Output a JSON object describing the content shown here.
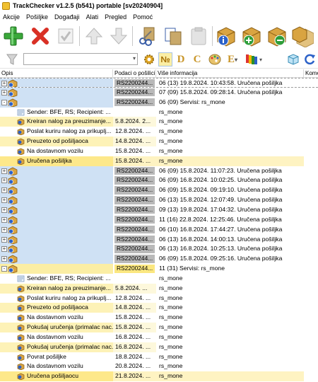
{
  "title": "TrackChecker v1.2.5 (b541)  portable [sv20240904]",
  "menu": [
    "Akcije",
    "Pošiljke",
    "Događaji",
    "Alati",
    "Pregled",
    "Pomoć"
  ],
  "toolbar1": [
    {
      "icon": "add-icon"
    },
    {
      "icon": "delete-icon"
    },
    {
      "icon": "check-icon"
    },
    {
      "icon": "arrow-up-icon"
    },
    {
      "icon": "arrow-down-icon"
    },
    {
      "icon": "cut-icon"
    },
    {
      "icon": "copy-icon"
    },
    {
      "icon": "paste-icon"
    },
    {
      "icon": "package-info-icon"
    },
    {
      "icon": "package-add-icon"
    },
    {
      "icon": "package-remove-icon"
    },
    {
      "icon": "package-refresh-icon"
    }
  ],
  "toolbar2": {
    "filter_value": "",
    "buttons": [
      {
        "icon": "gear-icon"
      },
      {
        "icon": "number-icon",
        "label": "№"
      },
      {
        "icon": "letter-d-icon",
        "label": "D"
      },
      {
        "icon": "letter-c-icon",
        "label": "C"
      },
      {
        "icon": "palette-icon"
      },
      {
        "icon": "letter-e-icon",
        "label": "E"
      },
      {
        "icon": "flags-icon"
      },
      {
        "icon": "cube-icon"
      },
      {
        "icon": "refresh-icon"
      }
    ]
  },
  "columns": {
    "c1": "Opis",
    "c2": "Podaci o pošilici",
    "c3": "Više informacija",
    "c4": "Kome"
  },
  "colors": {
    "parent_blue": "#cfe1f4",
    "parent_yellow": "#fbeea4",
    "badge_gray": "#b9b9b9",
    "badge_yellow": "#fbe780",
    "child_yellow": "#fdf2b7"
  },
  "rows": [
    {
      "kind": "parent",
      "style": "blue",
      "exp": "+",
      "c2": "RS2200244...",
      "c3": "06 (13) 19.8.2024. 10:43:58. Uručena pošiljka",
      "dashed": true
    },
    {
      "kind": "parent",
      "style": "blue",
      "exp": "+",
      "c2": "RS2200244...",
      "c3": "07 (09) 15.8.2024. 09:28:14. Uručena pošiljka"
    },
    {
      "kind": "parent",
      "style": "blue",
      "exp": "-",
      "c2": "RS2200244...",
      "c3": "06 (09) Servisi: rs_mone"
    },
    {
      "kind": "child",
      "style": "white",
      "icon": "sender",
      "c1": "Sender: BFE, RS; Recipient: ...",
      "c2": "",
      "c3": "rs_mone"
    },
    {
      "kind": "child",
      "style": "yel",
      "icon": "info",
      "c1": "Kreiran nalog za preuzimanje...",
      "c2": "5.8.2024. 2...",
      "c3": "rs_mone"
    },
    {
      "kind": "child",
      "style": "white",
      "icon": "info",
      "c1": "Poslat kuriru nalog za prikuplj...",
      "c2": "12.8.2024. ...",
      "c3": "rs_mone"
    },
    {
      "kind": "child",
      "style": "yel",
      "icon": "info",
      "c1": "Preuzeto od pošiljaoca",
      "c2": "14.8.2024. ...",
      "c3": "rs_mone"
    },
    {
      "kind": "child",
      "style": "white",
      "icon": "info",
      "c1": "Na dostavnom vozilu",
      "c2": "15.8.2024. ...",
      "c3": "rs_mone"
    },
    {
      "kind": "child",
      "style": "sel",
      "icon": "info",
      "c1": "Uručena pošiljka",
      "c2": "15.8.2024. ...",
      "c3": "rs_mone"
    },
    {
      "kind": "parent",
      "style": "blue",
      "exp": "+",
      "c2": "RS2200244...",
      "c3": "06 (09) 15.8.2024. 11:07:23. Uručena pošiljka"
    },
    {
      "kind": "parent",
      "style": "blue",
      "exp": "+",
      "c2": "RS2200244...",
      "c3": "06 (09) 16.8.2024. 10:02:25. Uručena pošiljka"
    },
    {
      "kind": "parent",
      "style": "blue",
      "exp": "+",
      "c2": "RS2200244...",
      "c3": "06 (09) 15.8.2024. 09:19:10. Uručena pošiljka"
    },
    {
      "kind": "parent",
      "style": "blue",
      "exp": "+",
      "c2": "RS2200244...",
      "c3": "06 (13) 15.8.2024. 12:07:49. Uručena pošiljka"
    },
    {
      "kind": "parent",
      "style": "blue",
      "exp": "+",
      "c2": "RS2200244...",
      "c3": "09 (13) 19.8.2024. 17:04:32. Uručena pošiljka"
    },
    {
      "kind": "parent",
      "style": "blue",
      "exp": "+",
      "c2": "RS2200244...",
      "c3": "11 (16) 22.8.2024. 12:25:46. Uručena pošiljka"
    },
    {
      "kind": "parent",
      "style": "blue",
      "exp": "+",
      "c2": "RS2200244...",
      "c3": "06 (10) 16.8.2024. 17:44:27. Uručena pošiljka"
    },
    {
      "kind": "parent",
      "style": "blue",
      "exp": "+",
      "c2": "RS2200244...",
      "c3": "06 (13) 16.8.2024. 14:00:13. Uručena pošiljka"
    },
    {
      "kind": "parent",
      "style": "blue",
      "exp": "+",
      "c2": "RS2200244...",
      "c3": "06 (13) 16.8.2024. 10:25:13. Uručena pošiljka"
    },
    {
      "kind": "parent",
      "style": "blue",
      "exp": "+",
      "c2": "RS2200244...",
      "c3": "06 (09) 15.8.2024. 09:25:16. Uručena pošiljka"
    },
    {
      "kind": "parent",
      "style": "yellow",
      "exp": "-",
      "c2": "RS2200244...",
      "c3": "11 (31) Servisi: rs_mone"
    },
    {
      "kind": "child",
      "style": "white",
      "icon": "sender",
      "c1": "Sender: BFE, RS; Recipient: ...",
      "c2": "",
      "c3": "rs_mone"
    },
    {
      "kind": "child",
      "style": "yel",
      "icon": "info",
      "c1": "Kreiran nalog za preuzimanje...",
      "c2": "5.8.2024. ...",
      "c3": "rs_mone"
    },
    {
      "kind": "child",
      "style": "white",
      "icon": "info",
      "c1": "Poslat kuriru nalog za prikuplj...",
      "c2": "12.8.2024. ...",
      "c3": "rs_mone"
    },
    {
      "kind": "child",
      "style": "yel",
      "icon": "info",
      "c1": "Preuzeto od pošiljaoca",
      "c2": "14.8.2024. ...",
      "c3": "rs_mone"
    },
    {
      "kind": "child",
      "style": "white",
      "icon": "info",
      "c1": "Na dostavnom vozilu",
      "c2": "15.8.2024. ...",
      "c3": "rs_mone"
    },
    {
      "kind": "child",
      "style": "yel",
      "icon": "info",
      "c1": "Pokušaj uručenja (primalac nac...",
      "c2": "15.8.2024. ...",
      "c3": "rs_mone"
    },
    {
      "kind": "child",
      "style": "white",
      "icon": "info",
      "c1": "Na dostavnom vozilu",
      "c2": "16.8.2024. ...",
      "c3": "rs_mone"
    },
    {
      "kind": "child",
      "style": "yel",
      "icon": "info",
      "c1": "Pokušaj uručenja (primalac nac...",
      "c2": "16.8.2024. ...",
      "c3": "rs_mone"
    },
    {
      "kind": "child",
      "style": "white",
      "icon": "info",
      "c1": "Povrat pošiljke",
      "c2": "18.8.2024. ...",
      "c3": "rs_mone"
    },
    {
      "kind": "child",
      "style": "white",
      "icon": "info",
      "c1": "Na dostavnom vozilu",
      "c2": "20.8.2024. ...",
      "c3": "rs_mone"
    },
    {
      "kind": "child",
      "style": "sel",
      "icon": "info",
      "c1": "Uručena pošiljaocu",
      "c2": "21.8.2024. ...",
      "c3": "rs_mone"
    }
  ]
}
